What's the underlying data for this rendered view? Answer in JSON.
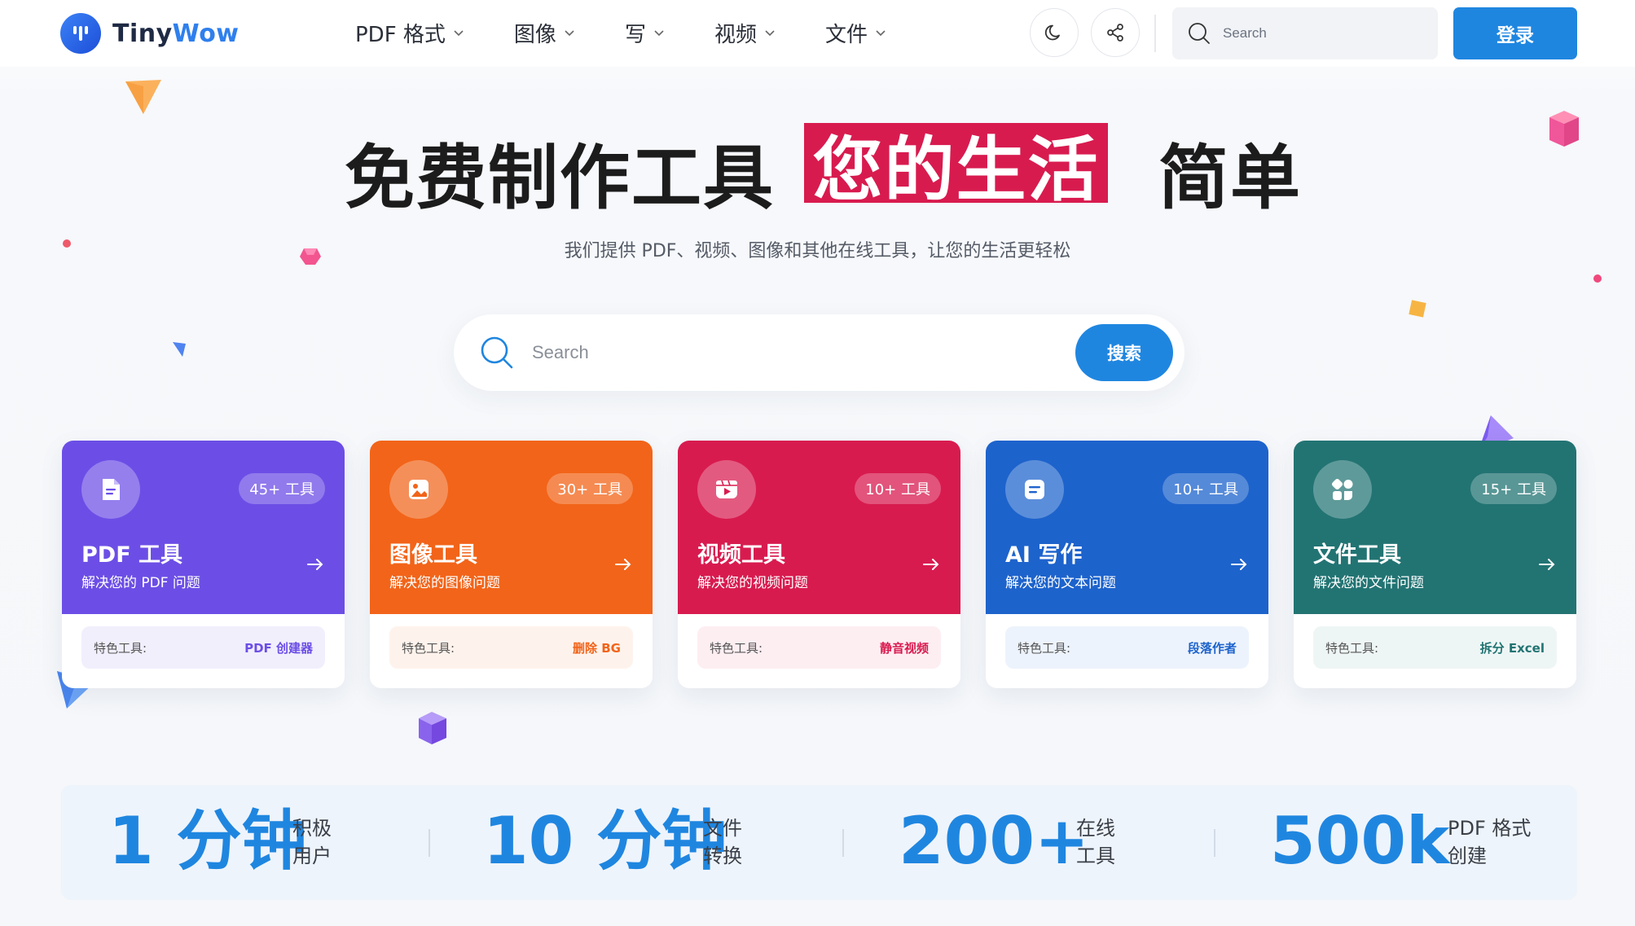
{
  "header": {
    "logo_part1": "Tiny",
    "logo_part2": "Wow",
    "nav": [
      "PDF 格式",
      "图像",
      "写",
      "视频",
      "文件"
    ],
    "search_placeholder": "Search",
    "login_label": "登录"
  },
  "hero": {
    "title_part1": "免费制作工具",
    "title_highlight": "您的生活",
    "title_part3": "简单",
    "subtitle": "我们提供 PDF、视频、图像和其他在线工具，让您的生活更轻松",
    "search_placeholder": "Search",
    "search_button": "搜索"
  },
  "cards": [
    {
      "badge": "45+ 工具",
      "title": "PDF 工具",
      "desc": "解决您的 PDF 问题",
      "feat_label": "特色工具:",
      "feat_value": "PDF 创建器",
      "color": "#6c4ee6",
      "accent": "#6c4ee6",
      "footbg": "#f1effc"
    },
    {
      "badge": "30+ 工具",
      "title": "图像工具",
      "desc": "解决您的图像问题",
      "feat_label": "特色工具:",
      "feat_value": "删除 BG",
      "color": "#f26419",
      "accent": "#f26419",
      "footbg": "#fef3ec"
    },
    {
      "badge": "10+ 工具",
      "title": "视频工具",
      "desc": "解决您的视频问题",
      "feat_label": "特色工具:",
      "feat_value": "静音视频",
      "color": "#d81b4f",
      "accent": "#d81b4f",
      "footbg": "#fdeef2"
    },
    {
      "badge": "10+ 工具",
      "title": "AI 写作",
      "desc": "解决您的文本问题",
      "feat_label": "特色工具:",
      "feat_value": "段落作者",
      "color": "#1d63cc",
      "accent": "#1d63cc",
      "footbg": "#edf3fc"
    },
    {
      "badge": "15+ 工具",
      "title": "文件工具",
      "desc": "解决您的文件问题",
      "feat_label": "特色工具:",
      "feat_value": "拆分 Excel",
      "color": "#227473",
      "accent": "#227473",
      "footbg": "#eef6f5"
    }
  ],
  "stats": [
    {
      "value": "1 分钟",
      "label_line1": "积极",
      "label_line2": "用户"
    },
    {
      "value": "10 分钟",
      "label_line1": "文件",
      "label_line2": "转换"
    },
    {
      "value": "200+",
      "label_line1": "在线",
      "label_line2": "工具"
    },
    {
      "value": "500k",
      "label_line1": "PDF 格式",
      "label_line2": "创建"
    }
  ]
}
